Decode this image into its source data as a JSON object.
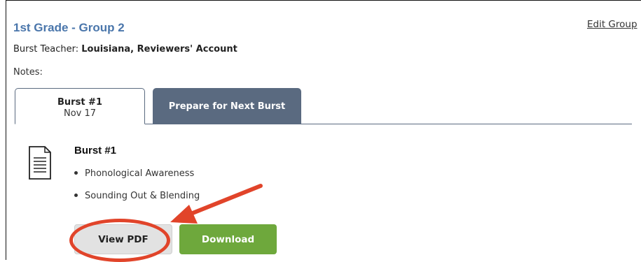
{
  "group": {
    "title": "1st Grade - Group 2",
    "edit_label": "Edit Group"
  },
  "teacher": {
    "label": "Burst Teacher:",
    "name": "Louisiana, Reviewers' Account"
  },
  "notes": {
    "label": "Notes:"
  },
  "tabs": [
    {
      "title": "Burst #1",
      "date": "Nov 17",
      "active": true
    },
    {
      "title": "Prepare for Next Burst",
      "active": false
    }
  ],
  "burst": {
    "icon": "document-icon",
    "heading": "Burst #1",
    "topics": [
      "Phonological Awareness",
      "Sounding Out & Blending"
    ]
  },
  "actions": {
    "view_pdf": "View PDF",
    "download": "Download"
  },
  "colors": {
    "title_blue": "#4a76ab",
    "tab_slate": "#5a6a80",
    "download_green": "#6ea83c",
    "annotation_red": "#e1442a"
  }
}
